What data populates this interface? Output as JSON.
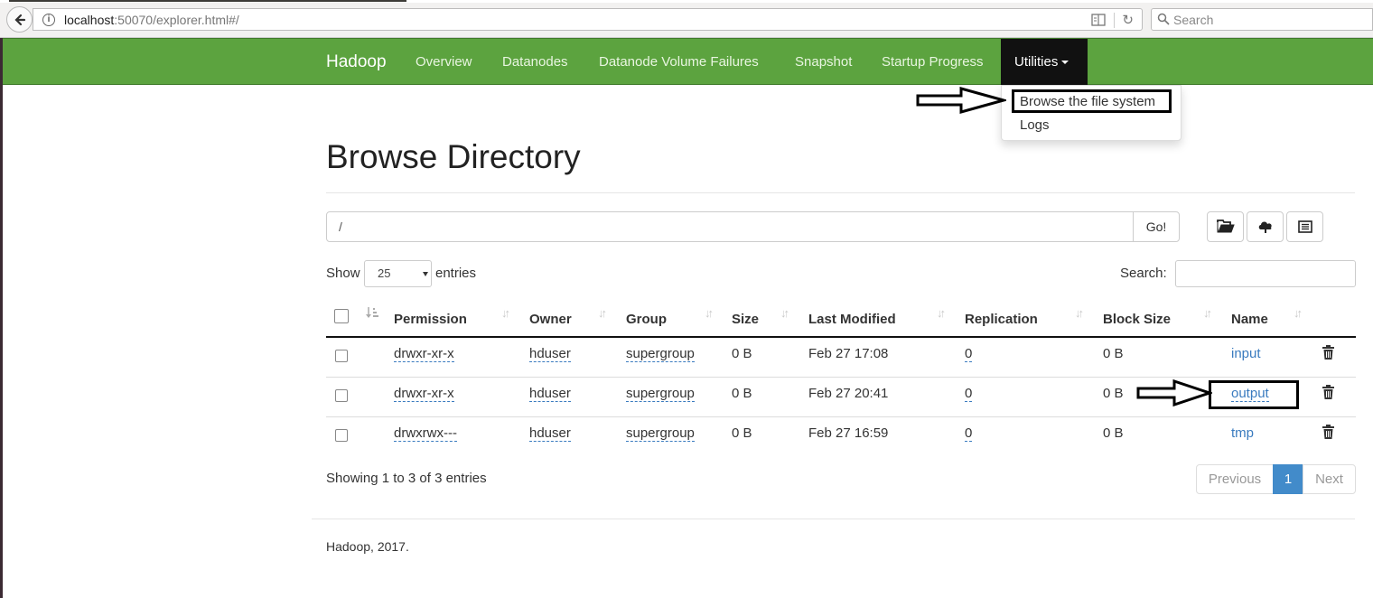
{
  "browser": {
    "url_host": "localhost",
    "url_rest": ":50070/explorer.html#/",
    "search_placeholder": "Search"
  },
  "navbar": {
    "brand": "Hadoop",
    "items": [
      "Overview",
      "Datanodes",
      "Datanode Volume Failures",
      "Snapshot",
      "Startup Progress"
    ],
    "utilities": "Utilities",
    "colors": {
      "background": "#5ca33f",
      "active": "#111111"
    }
  },
  "dropdown": {
    "items": [
      "Browse the file system",
      "Logs"
    ]
  },
  "page": {
    "title": "Browse Directory",
    "path_value": "/",
    "go_label": "Go!"
  },
  "table_controls": {
    "show_label": "Show",
    "entries_value": "25",
    "entries_label": "entries",
    "search_label": "Search:"
  },
  "table": {
    "columns": [
      "Permission",
      "Owner",
      "Group",
      "Size",
      "Last Modified",
      "Replication",
      "Block Size",
      "Name"
    ],
    "rows": [
      {
        "permission": "drwxr-xr-x",
        "owner": "hduser",
        "group": "supergroup",
        "size": "0 B",
        "modified": "Feb 27 17:08",
        "replication": "0",
        "block_size": "0 B",
        "name": "input"
      },
      {
        "permission": "drwxr-xr-x",
        "owner": "hduser",
        "group": "supergroup",
        "size": "0 B",
        "modified": "Feb 27 20:41",
        "replication": "0",
        "block_size": "0 B",
        "name": "output"
      },
      {
        "permission": "drwxrwx---",
        "owner": "hduser",
        "group": "supergroup",
        "size": "0 B",
        "modified": "Feb 27 16:59",
        "replication": "0",
        "block_size": "0 B",
        "name": "tmp"
      }
    ]
  },
  "pagination": {
    "info": "Showing 1 to 3 of 3 entries",
    "previous": "Previous",
    "current": "1",
    "next": "Next"
  },
  "footer": {
    "text": "Hadoop, 2017."
  }
}
